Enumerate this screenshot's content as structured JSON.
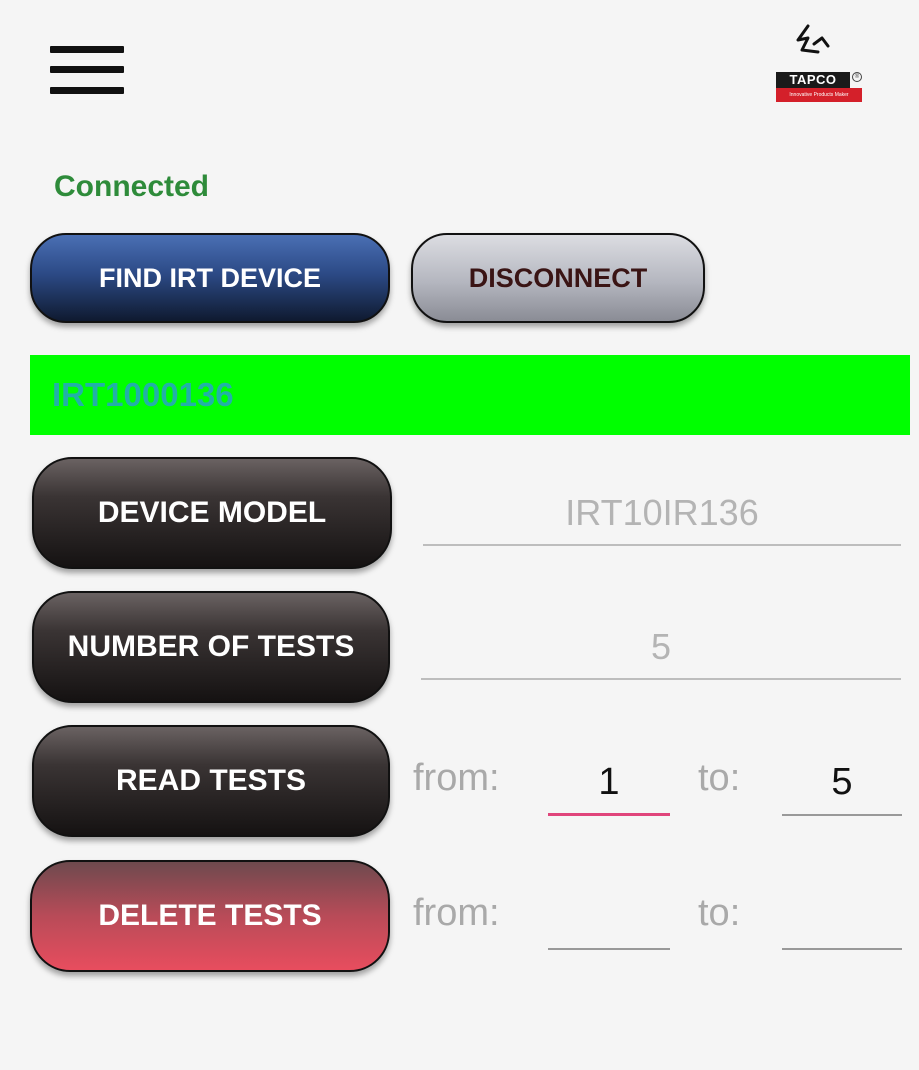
{
  "header": {
    "menu_icon": "hamburger-menu-icon",
    "logo": {
      "badge_text": "TAPCO",
      "strip_text": "Innovative Products Maker",
      "registered_mark": "®",
      "brand_color": "#d4202a"
    }
  },
  "connection": {
    "status": "Connected",
    "status_color": "#2e8b3a"
  },
  "buttons": {
    "find_device": "FIND IRT DEVICE",
    "disconnect": "DISCONNECT",
    "device_model": "DEVICE MODEL",
    "number_of_tests": "NUMBER OF TESTS",
    "read_tests": "READ TESTS",
    "delete_tests": "DELETE TESTS"
  },
  "device": {
    "name": "IRT1000136",
    "bar_color": "#00ff00"
  },
  "fields": {
    "device_model_value": "IRT10IR136",
    "number_of_tests_value": "5"
  },
  "read_range": {
    "from_label": "from:",
    "to_label": "to:",
    "from_value": "1",
    "to_value": "5"
  },
  "delete_range": {
    "from_label": "from:",
    "to_label": "to:",
    "from_value": "",
    "to_value": ""
  }
}
